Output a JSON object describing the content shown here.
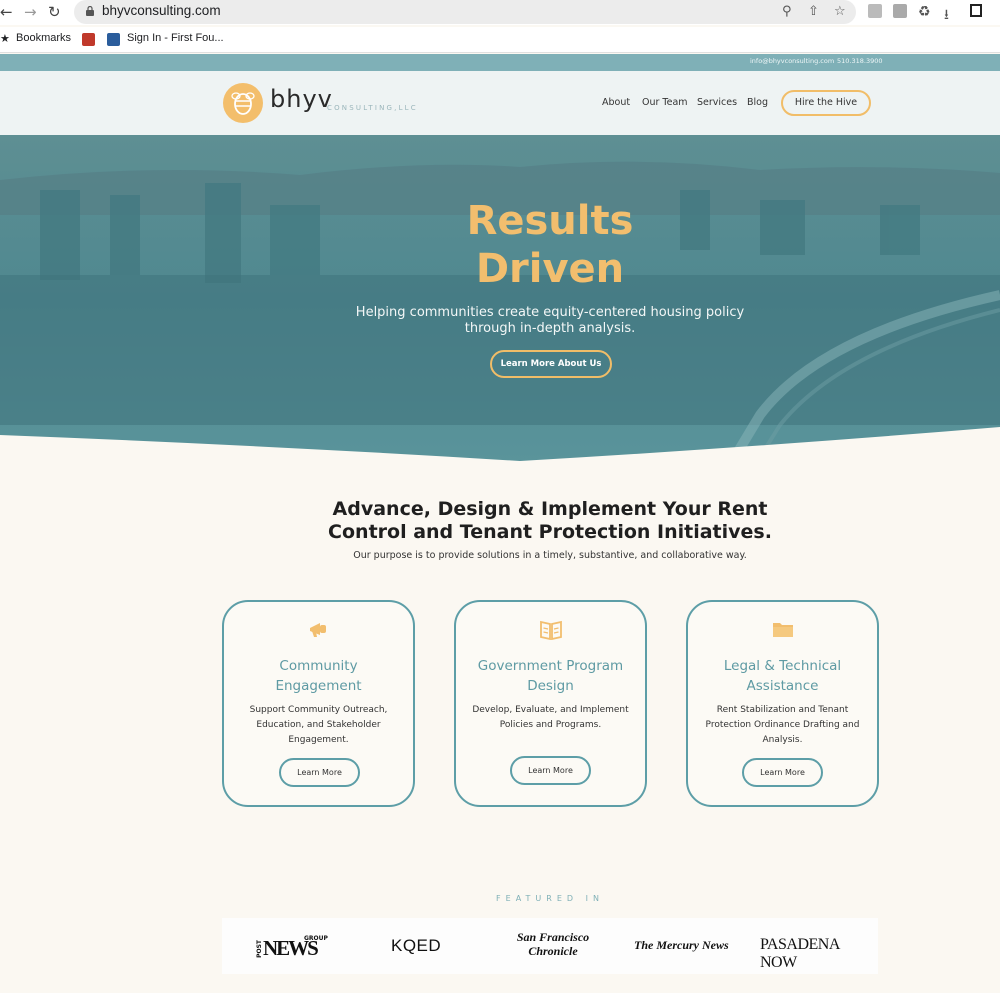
{
  "browser": {
    "url": "bhyvconsulting.com",
    "bookmarks": [
      {
        "label": "Bookmarks"
      },
      {
        "label": "Sign In - First Fou..."
      }
    ]
  },
  "topbar": {
    "email": "info@bhyvconsulting.com",
    "phone": "510.318.3900"
  },
  "header": {
    "logo_name": "bhyv",
    "logo_sub": "CONSULTING,LLC",
    "nav": [
      "About",
      "Our Team",
      "Services",
      "Blog"
    ],
    "cta": "Hire the Hive"
  },
  "hero": {
    "title_line1": "Results",
    "title_line2": "Driven",
    "subtitle_line1": "Helping communities create equity-centered housing policy",
    "subtitle_line2": "through in-depth analysis.",
    "button": "Learn More About Us"
  },
  "section": {
    "title_line1": "Advance, Design & Implement Your Rent",
    "title_line2": "Control and Tenant Protection Initiatives.",
    "subtitle": "Our purpose is to provide solutions in a timely, substantive, and collaborative way."
  },
  "cards": [
    {
      "icon": "megaphone-icon",
      "title_line1": "Community",
      "title_line2": "Engagement",
      "desc_line1": "Support Community Outreach,",
      "desc_line2": "Education, and Stakeholder",
      "desc_line3": "Engagement.",
      "button": "Learn More"
    },
    {
      "icon": "book-icon",
      "title_line1": "Government Program",
      "title_line2": "Design",
      "desc_line1": "Develop, Evaluate, and Implement",
      "desc_line2": "Policies and Programs.",
      "desc_line3": "",
      "button": "Learn More"
    },
    {
      "icon": "folder-icon",
      "title_line1": "Legal & Technical",
      "title_line2": "Assistance",
      "desc_line1": "Rent Stabilization and Tenant",
      "desc_line2": "Protection Ordinance Drafting and",
      "desc_line3": "Analysis.",
      "button": "Learn More"
    }
  ],
  "featured": {
    "label": "FEATURED IN",
    "outlets": [
      "NEWS",
      "KQED",
      "San Francisco Chronicle",
      "The Mercury News",
      "PASADENA NOW"
    ],
    "news_group_label": "GROUP",
    "news_post_label": "POST"
  },
  "colors": {
    "accent": "#f2be6e",
    "teal": "#5d9ea7",
    "hero_overlay": "#4f8b93",
    "background": "#fbf8f2"
  }
}
